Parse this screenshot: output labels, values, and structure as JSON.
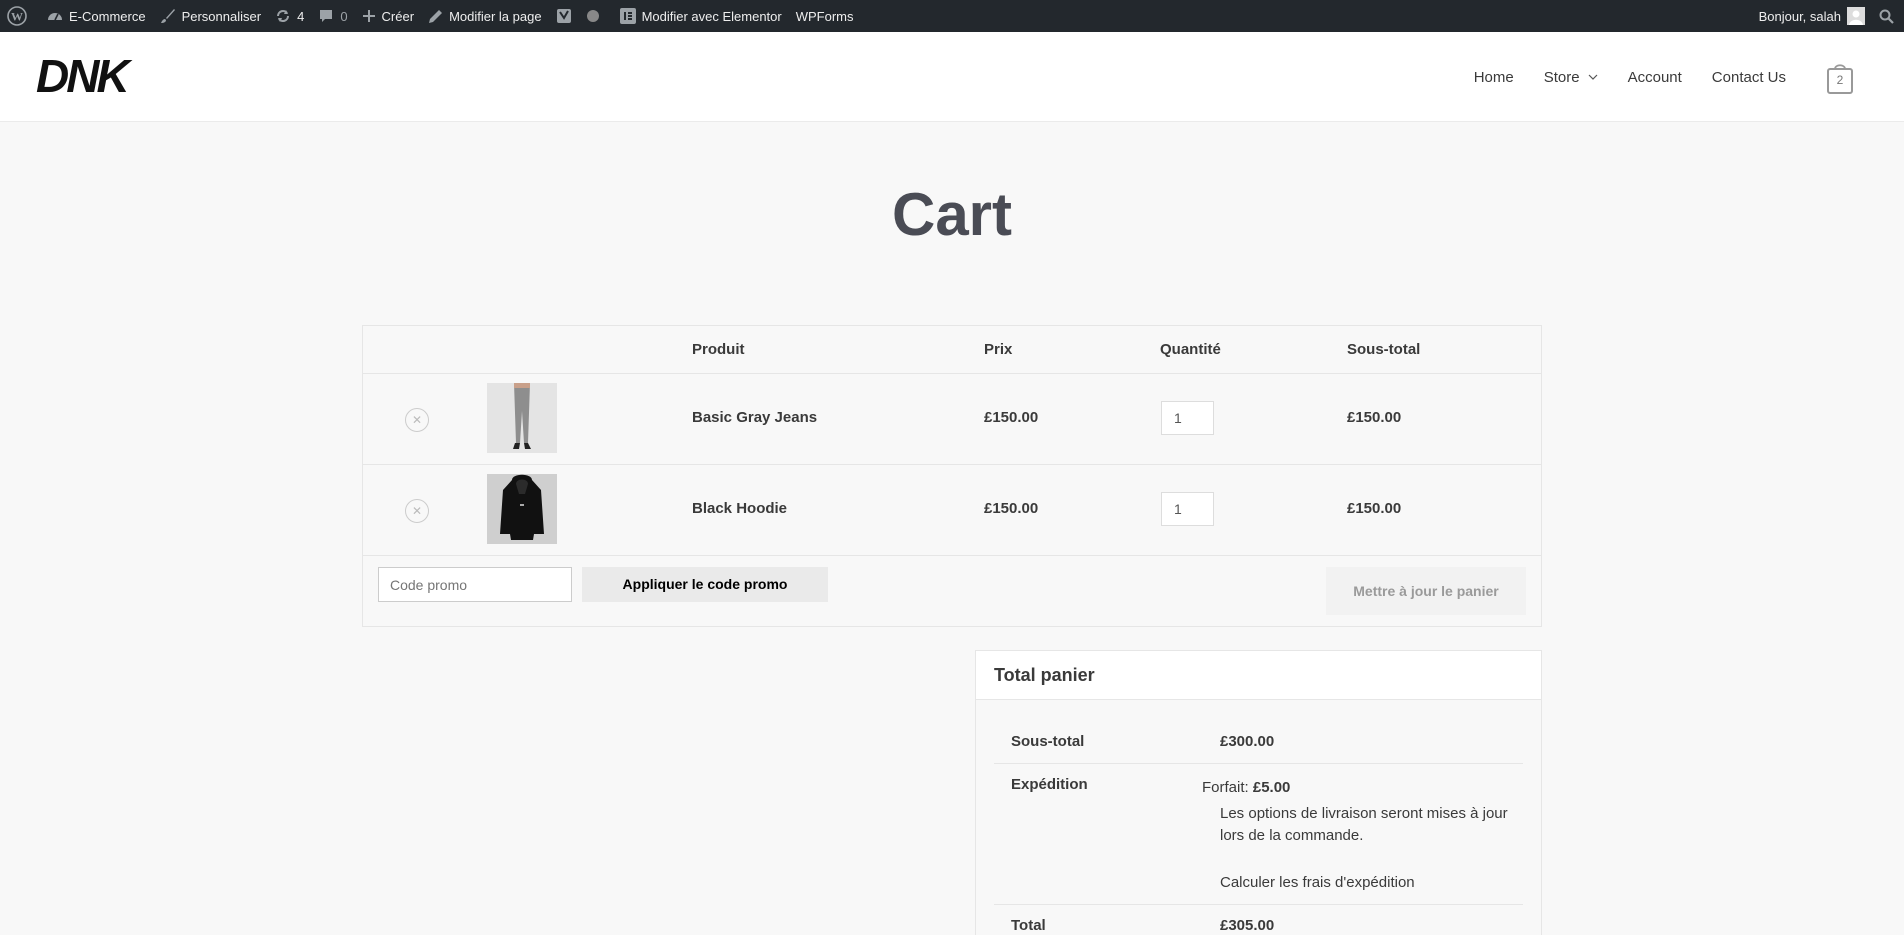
{
  "adminbar": {
    "site_name": "E-Commerce",
    "customize": "Personnaliser",
    "updates_count": "4",
    "comments_count": "0",
    "new": "Créer",
    "edit_page": "Modifier la page",
    "elementor": "Modifier avec Elementor",
    "wpforms": "WPForms",
    "greeting": "Bonjour, salah"
  },
  "header": {
    "logo_text": "DNK",
    "nav": [
      "Home",
      "Store",
      "Account",
      "Contact Us"
    ],
    "cart_count": "2"
  },
  "page": {
    "title": "Cart"
  },
  "cart": {
    "columns": {
      "product": "Produit",
      "price": "Prix",
      "quantity": "Quantité",
      "subtotal": "Sous-total"
    },
    "items": [
      {
        "name": "Basic Gray Jeans",
        "price": "£150.00",
        "quantity": "1",
        "subtotal": "£150.00"
      },
      {
        "name": "Black Hoodie",
        "price": "£150.00",
        "quantity": "1",
        "subtotal": "£150.00"
      }
    ],
    "promo_placeholder": "Code promo",
    "apply_promo": "Appliquer le code promo",
    "update_cart": "Mettre à jour le panier"
  },
  "totals": {
    "heading": "Total panier",
    "subtotal_label": "Sous-total",
    "subtotal_value": "£300.00",
    "shipping_label": "Expédition",
    "shipping_method": "Forfait:",
    "shipping_price": "£5.00",
    "shipping_note": "Les options de livraison seront mises à jour lors de la commande.",
    "calc_shipping": "Calculer les frais d'expédition",
    "total_label": "Total",
    "total_value": "£305.00"
  }
}
